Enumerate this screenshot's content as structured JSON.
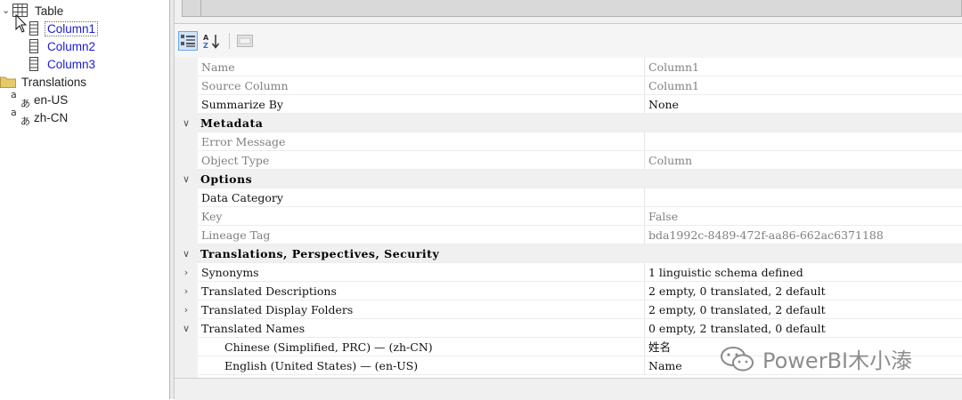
{
  "tree": {
    "table_label": "Table",
    "columns": [
      "Column1",
      "Column2",
      "Column3"
    ],
    "translations_label": "Translations",
    "cultures": [
      "en-US",
      "zh-CN"
    ]
  },
  "properties": [
    {
      "kind": "prop",
      "name": "Name",
      "value": "Column1",
      "readonly": true
    },
    {
      "kind": "prop",
      "name": "Source Column",
      "value": "Column1",
      "readonly": true
    },
    {
      "kind": "prop",
      "name": "Summarize By",
      "value": "None",
      "readonly": false
    },
    {
      "kind": "cat",
      "name": "Metadata",
      "expander": "v"
    },
    {
      "kind": "prop",
      "name": "Error Message",
      "value": "",
      "readonly": true
    },
    {
      "kind": "prop",
      "name": "Object Type",
      "value": "Column",
      "readonly": true
    },
    {
      "kind": "cat",
      "name": "Options",
      "expander": "v"
    },
    {
      "kind": "prop",
      "name": "Data Category",
      "value": "",
      "readonly": false
    },
    {
      "kind": "prop",
      "name": "Key",
      "value": "False",
      "readonly": true
    },
    {
      "kind": "prop",
      "name": "Lineage Tag",
      "value": "bda1992c-8489-472f-aa86-662ac6371188",
      "readonly": true
    },
    {
      "kind": "cat",
      "name": "Translations, Perspectives, Security",
      "expander": "v"
    },
    {
      "kind": "prop",
      "name": "Synonyms",
      "value": "1 linguistic schema defined",
      "readonly": false,
      "expander": ">"
    },
    {
      "kind": "prop",
      "name": "Translated Descriptions",
      "value": "2 empty, 0 translated, 2 default",
      "readonly": false,
      "expander": ">"
    },
    {
      "kind": "prop",
      "name": "Translated Display Folders",
      "value": "2 empty, 0 translated, 2 default",
      "readonly": false,
      "expander": ">"
    },
    {
      "kind": "prop",
      "name": "Translated Names",
      "value": "0 empty, 2 translated, 0 default",
      "readonly": false,
      "expander": "v"
    },
    {
      "kind": "sub",
      "name": "Chinese (Simplified, PRC) — (zh-CN)",
      "value": "姓名",
      "readonly": false
    },
    {
      "kind": "sub",
      "name": "English (United States) — (en-US)",
      "value": "Name",
      "readonly": false
    }
  ],
  "watermark": "PowerBI木小溙"
}
